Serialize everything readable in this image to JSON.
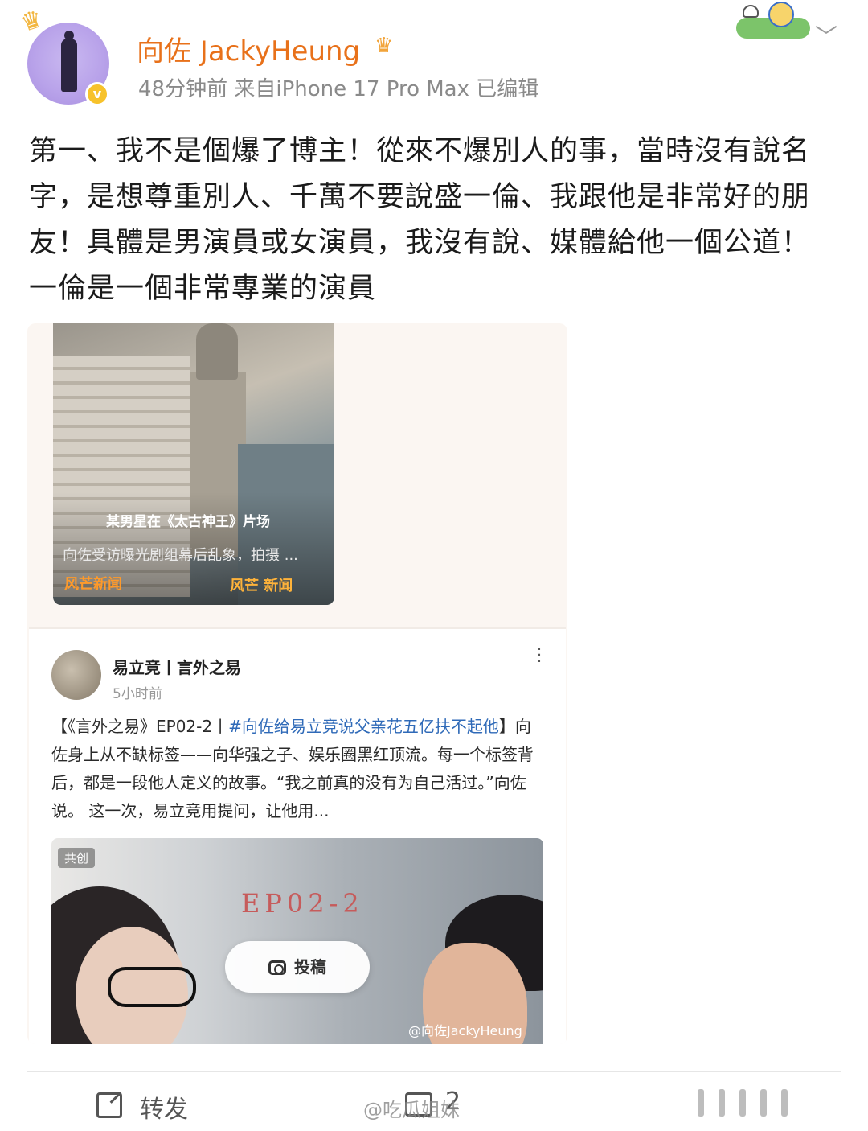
{
  "post": {
    "user_name": "向佐 JackyHeung",
    "meta": "48分钟前  来自iPhone 17 Pro Max  已编辑",
    "text": "第一、我不是個爆了博主！從來不爆別人的事，當時沒有說名字，是想尊重別人、千萬不要說盛一倫、我跟他是非常好的朋友！具體是男演員或女演員，我沒有說、媒體給他一個公道！一倫是一個非常專業的演員"
  },
  "video": {
    "title": "某男星在《太古神王》片场",
    "subtitle": "向佐受访曝光剧组幕后乱象，拍摄 ...",
    "logo_left": "风芒新闻",
    "logo_right": "风芒 新闻"
  },
  "card": {
    "author": "易立竞丨言外之易",
    "time": "5小时前",
    "text_prefix": "【《言外之易》EP02-2丨",
    "hashtag": "#向佐给易立竞说父亲花五亿扶不起他",
    "text_body": "】向佐身上从不缺标签——向华强之子、娱乐圈黑红顶流。每一个标签背后，都是一段他人定义的故事。“我之前真的没有为自己活过。”向佐说。 这一次，易立竞用提问，让他用...",
    "badge": "共创",
    "episode": "EP02-2",
    "submit_label": "投稿",
    "watermark": "@向佐JackyHeung"
  },
  "footer": {
    "repost_label": "转发",
    "comment_count": "2",
    "watermark": "@吃瓜姐妹"
  },
  "colors": {
    "username": "#e8711a",
    "hashtag": "#2f6ab8",
    "meta": "#8a8a8a"
  },
  "icons": [
    "crown-icon",
    "verified-icon",
    "chevron-down-icon",
    "camera-icon",
    "repost-icon",
    "comment-icon",
    "like-icon",
    "more-icon"
  ]
}
